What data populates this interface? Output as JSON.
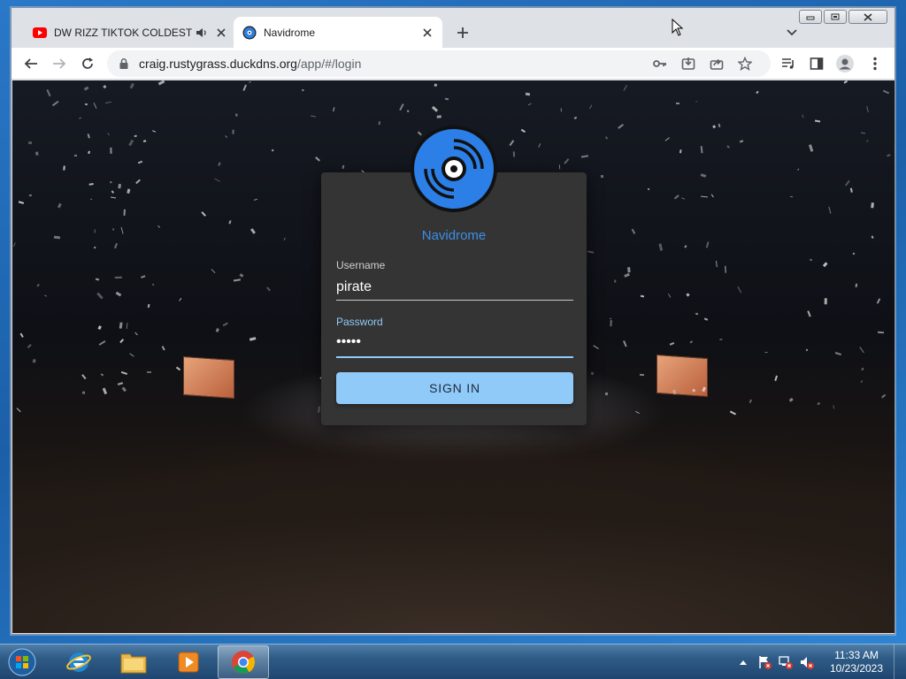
{
  "browser": {
    "tabs": [
      {
        "title": "DW RIZZ TIKTOK COLDEST M",
        "favicon": "youtube-icon",
        "muted_icon": "speaker-icon",
        "active": false
      },
      {
        "title": "Navidrome",
        "favicon": "navidrome-icon",
        "active": true
      }
    ],
    "url_host": "craig.rustygrass.duckdns.org",
    "url_path": "/app/#/login"
  },
  "login": {
    "brand": "Navidrome",
    "username_label": "Username",
    "username_value": "pirate",
    "password_label": "Password",
    "password_value": "•••••",
    "signin_label": "SIGN IN"
  },
  "taskbar": {
    "time": "11:33 AM",
    "date": "10/23/2023"
  },
  "colors": {
    "accent": "#90caf9",
    "brand": "#3d8fe8",
    "card": "#343434"
  }
}
